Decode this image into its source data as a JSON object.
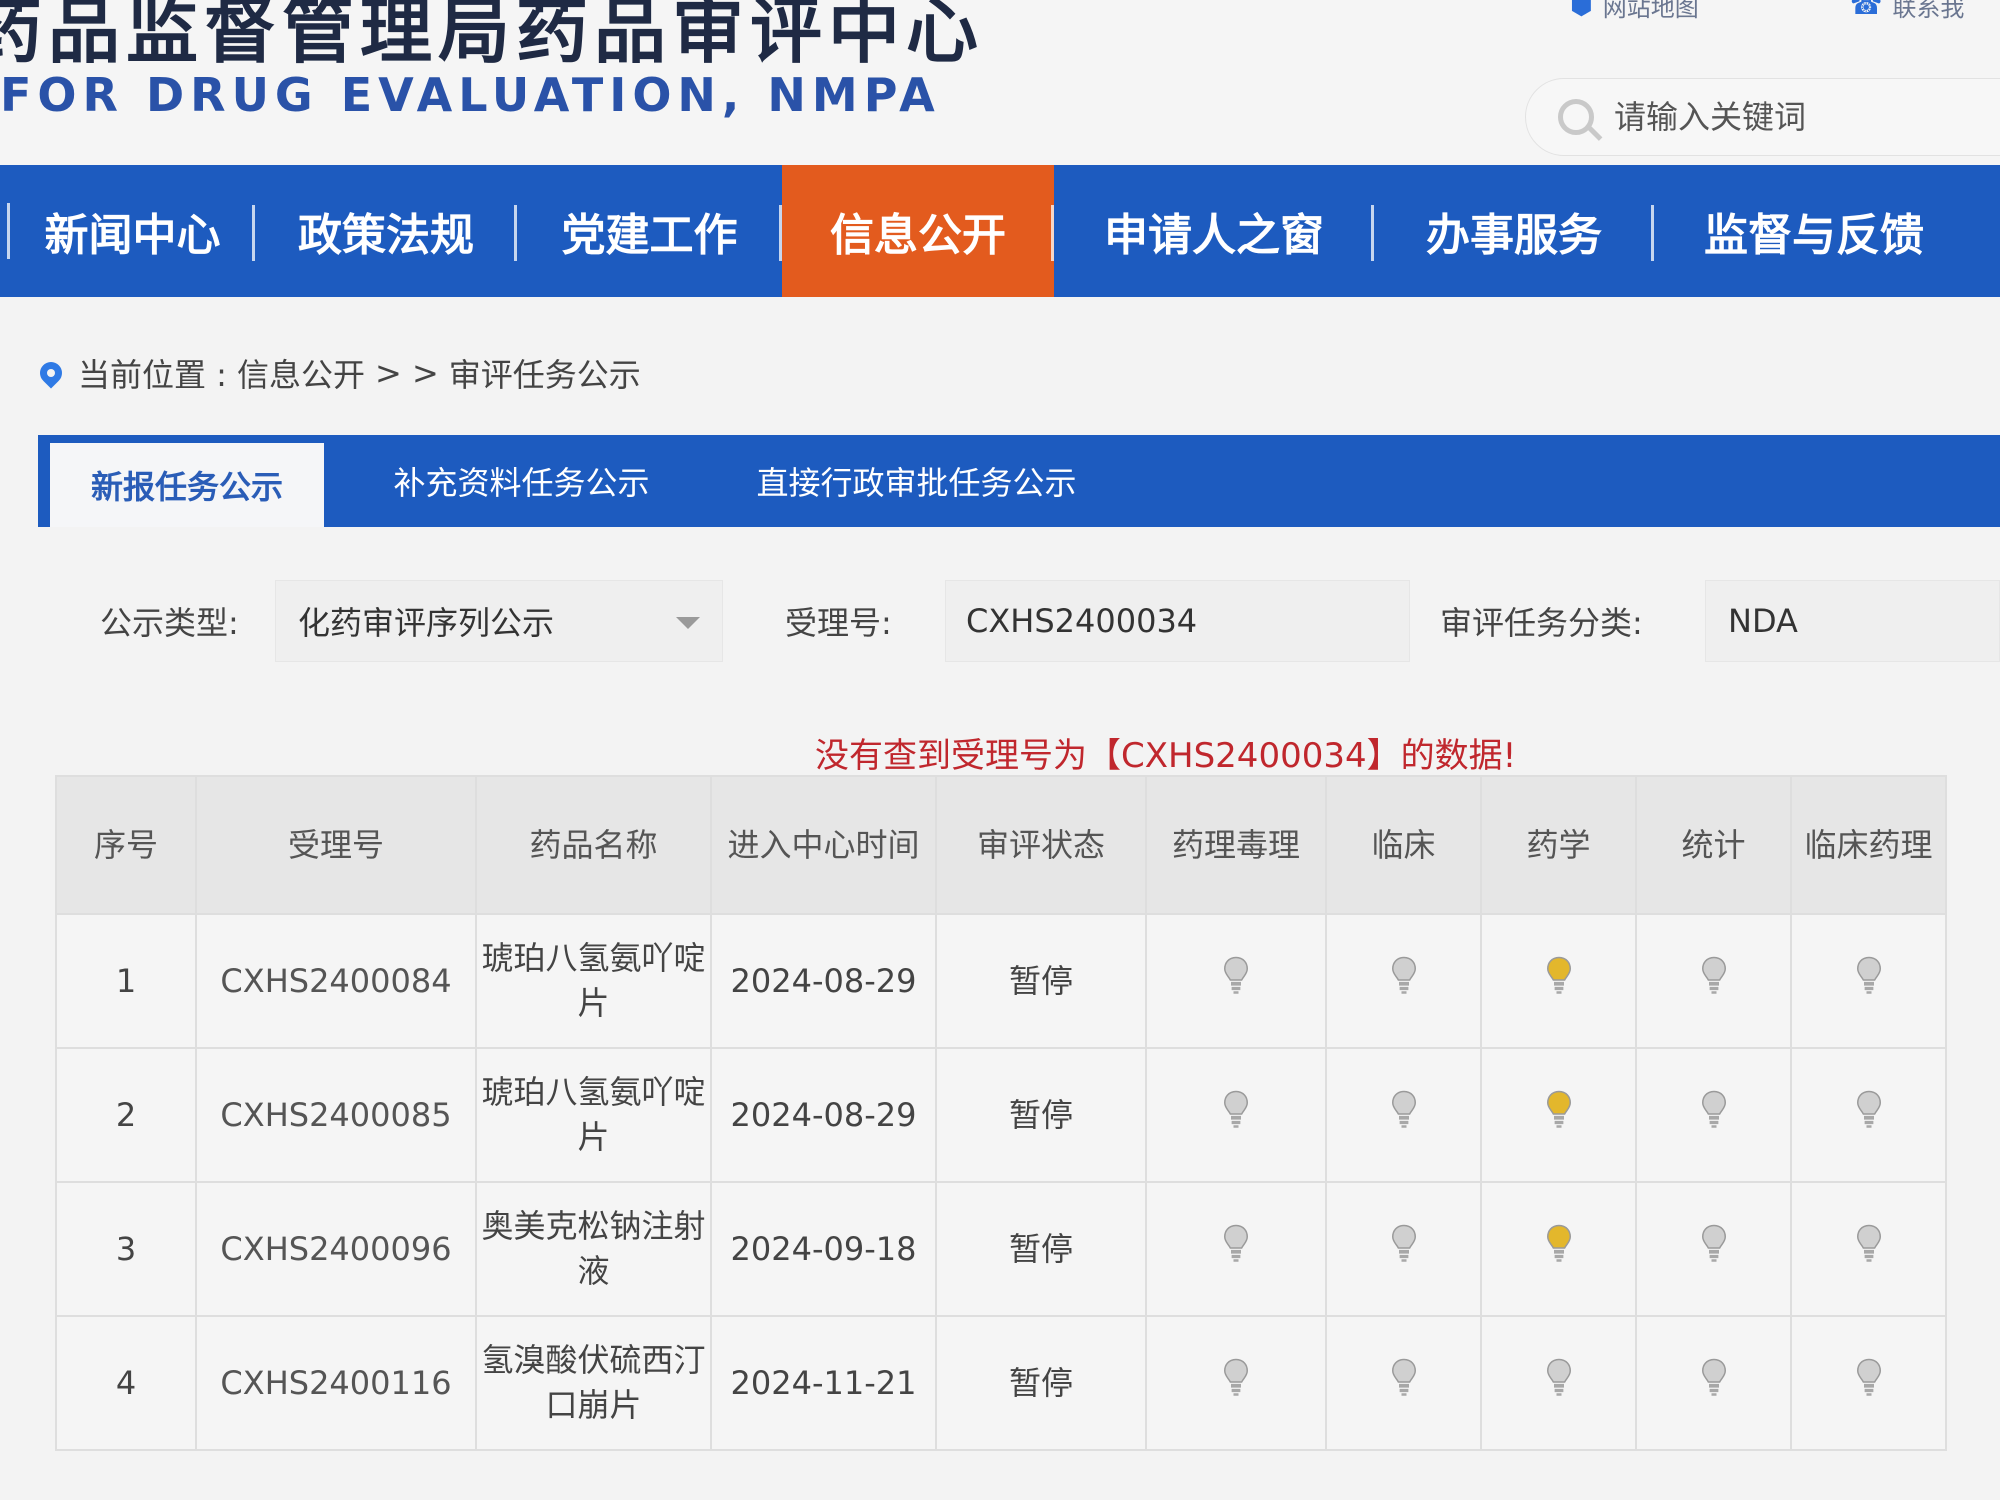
{
  "header": {
    "title": "药品监督管理局药品审评中心",
    "subtitle": "FOR DRUG EVALUATION, NMPA",
    "links": [
      {
        "label": "网站地图",
        "icon": "location-icon"
      },
      {
        "label": "联系我",
        "icon": "phone-icon"
      }
    ],
    "search_placeholder": "请输入关键词"
  },
  "nav": {
    "items": [
      {
        "label": "新闻中心",
        "active": false
      },
      {
        "label": "政策法规",
        "active": false
      },
      {
        "label": "党建工作",
        "active": false
      },
      {
        "label": "信息公开",
        "active": true
      },
      {
        "label": "申请人之窗",
        "active": false
      },
      {
        "label": "办事服务",
        "active": false
      },
      {
        "label": "监督与反馈",
        "active": false
      }
    ],
    "active_color": "#e35b1e",
    "bar_color": "#1d5bbf"
  },
  "breadcrumb": {
    "prefix": "当前位置 : ",
    "parent": "信息公开",
    "separator": " > > ",
    "current": "审评任务公示"
  },
  "sub_tabs": [
    {
      "label": "新报任务公示",
      "active": true
    },
    {
      "label": "补充资料任务公示",
      "active": false
    },
    {
      "label": "直接行政审批任务公示",
      "active": false
    }
  ],
  "filters": {
    "type_label": "公示类型:",
    "type_value": "化药审评序列公示",
    "accept_label": "受理号:",
    "accept_value": "CXHS2400034",
    "category_label": "审评任务分类:",
    "category_value": "NDA"
  },
  "message": "没有查到受理号为【CXHS2400034】的数据!",
  "table": {
    "headers": [
      "序号",
      "受理号",
      "药品名称",
      "进入中心时间",
      "审评状态",
      "药理毒理",
      "临床",
      "药学",
      "统计",
      "临床药理"
    ],
    "bulb_active_color": "#e3b72c",
    "bulb_inactive_color": "#d0d0d0",
    "rows": [
      {
        "no": "1",
        "code": "CXHS2400084",
        "name": "琥珀八氢氨吖啶片",
        "date": "2024-08-29",
        "status": "暂停",
        "lights": [
          false,
          false,
          true,
          false,
          false
        ]
      },
      {
        "no": "2",
        "code": "CXHS2400085",
        "name": "琥珀八氢氨吖啶片",
        "date": "2024-08-29",
        "status": "暂停",
        "lights": [
          false,
          false,
          true,
          false,
          false
        ]
      },
      {
        "no": "3",
        "code": "CXHS2400096",
        "name": "奥美克松钠注射液",
        "date": "2024-09-18",
        "status": "暂停",
        "lights": [
          false,
          false,
          true,
          false,
          false
        ]
      },
      {
        "no": "4",
        "code": "CXHS2400116",
        "name": "氢溴酸伏硫西汀口崩片",
        "date": "2024-11-21",
        "status": "暂停",
        "lights": [
          false,
          false,
          false,
          false,
          false
        ]
      }
    ]
  }
}
